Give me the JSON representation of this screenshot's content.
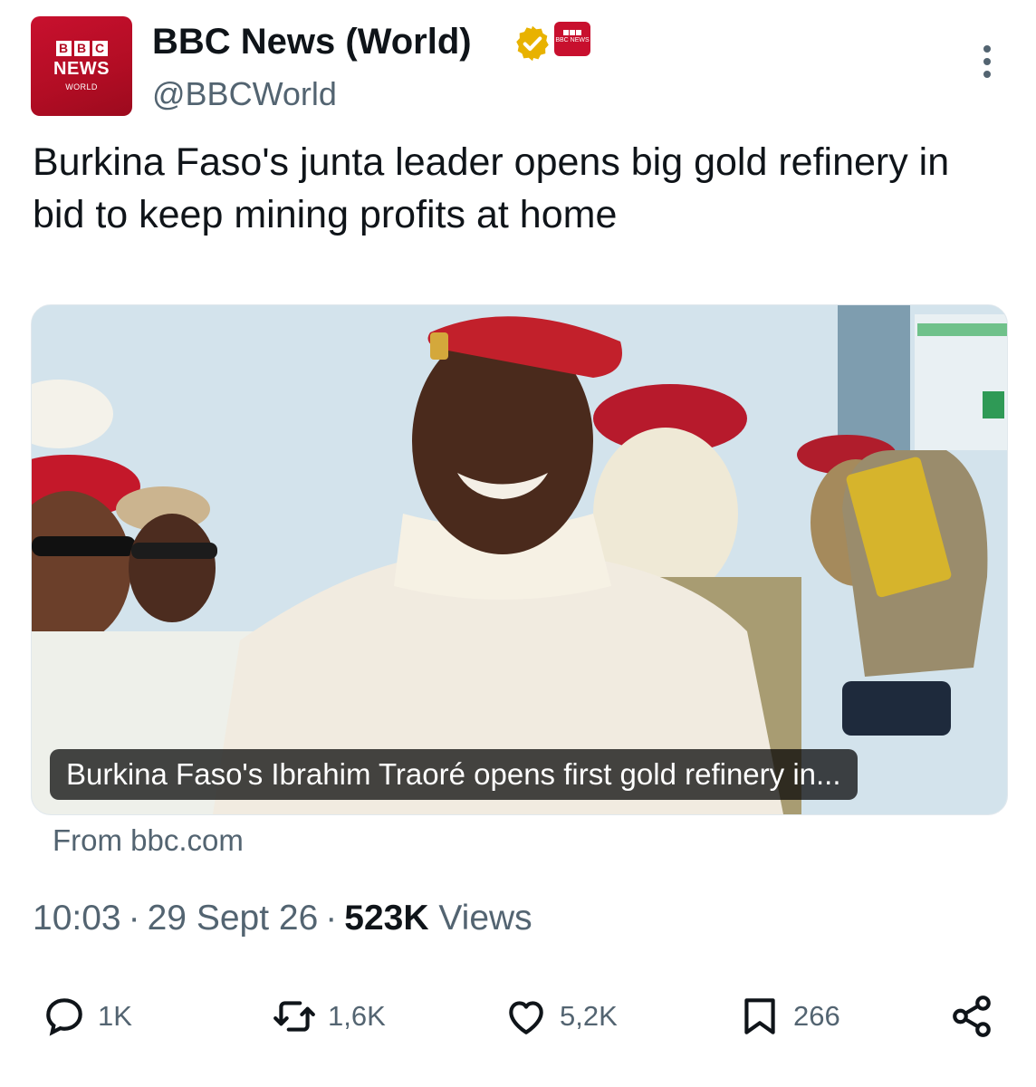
{
  "account": {
    "avatar": {
      "bbc_letters": [
        "B",
        "B",
        "C"
      ],
      "news": "NEWS",
      "world": "WORLD"
    },
    "display_name": "BBC News (World)",
    "handle": "@BBCWorld",
    "verified_color": "#e8b200",
    "affiliate_badge": "BBC NEWS"
  },
  "tweet": {
    "text": "Burkina Faso's junta leader opens big gold refinery in bid to keep mining profits at home"
  },
  "card": {
    "caption": "Burkina Faso's Ibrahim Traoré opens first gold refinery in...",
    "source": "From bbc.com"
  },
  "meta": {
    "time": "10:03",
    "date": "29 Sept 26",
    "views_count": "523K",
    "views_label": "Views",
    "separator": "·"
  },
  "actions": {
    "reply_count": "1K",
    "retweet_count": "1,6K",
    "like_count": "5,2K",
    "bookmark_count": "266"
  },
  "icons": {
    "reply": "reply-icon",
    "retweet": "retweet-icon",
    "like": "heart-icon",
    "bookmark": "bookmark-icon",
    "share": "share-icon",
    "more": "more-icon",
    "verified": "verified-badge-icon"
  },
  "colors": {
    "text_primary": "#0f1419",
    "text_secondary": "#536471",
    "bbc_red": "#c8102e"
  }
}
